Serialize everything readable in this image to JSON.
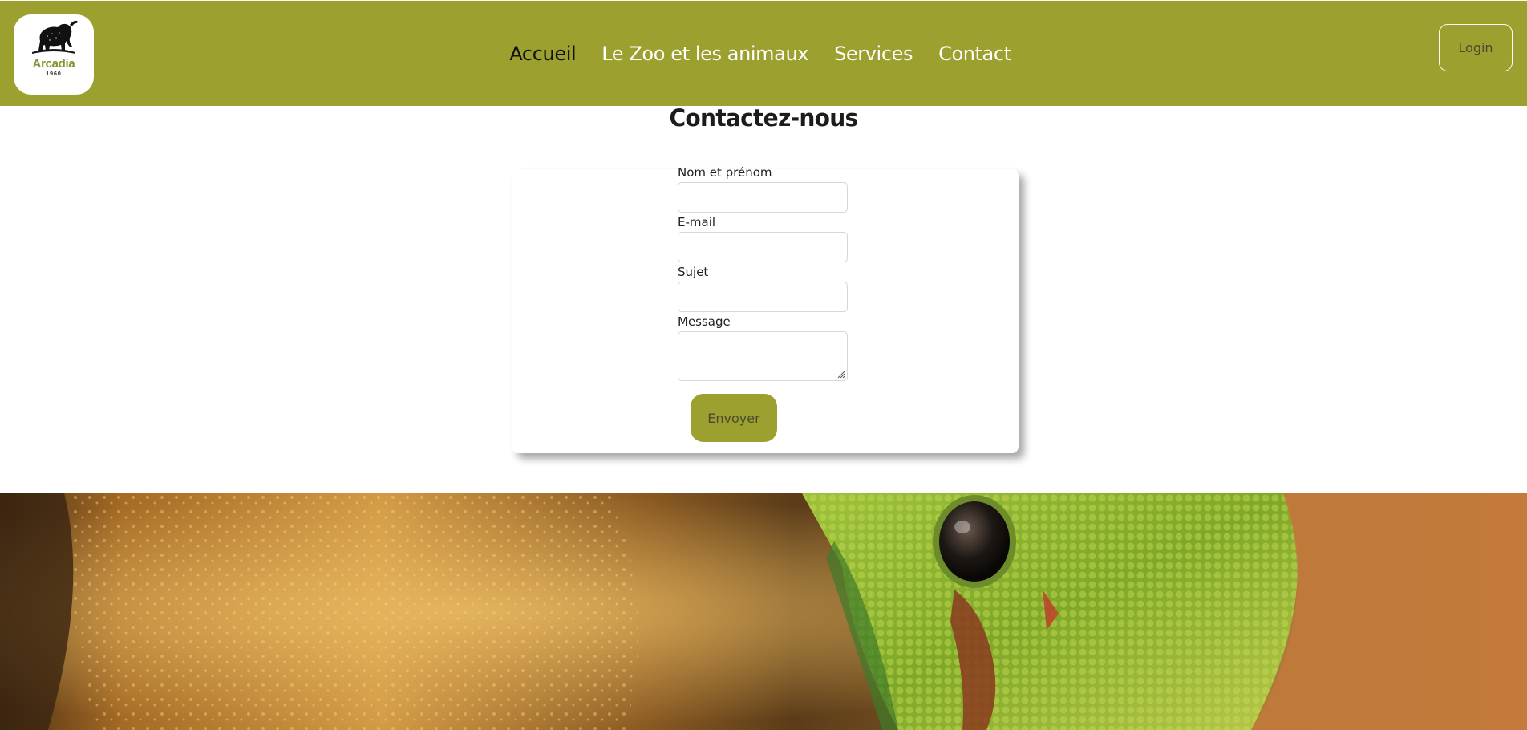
{
  "brand": {
    "logo_name": "Arcadia",
    "logo_year": "1960",
    "logo_icon": "elephant-icon"
  },
  "nav": {
    "items": [
      {
        "label": "Accueil",
        "active": true
      },
      {
        "label": "Le Zoo et les animaux",
        "active": false
      },
      {
        "label": "Services",
        "active": false
      },
      {
        "label": "Contact",
        "active": false
      }
    ],
    "login_label": "Login"
  },
  "contact": {
    "title": "Contactez-nous",
    "fields": {
      "name_label": "Nom et prénom",
      "email_label": "E-mail",
      "subject_label": "Sujet",
      "message_label": "Message"
    },
    "submit_label": "Envoyer"
  },
  "colors": {
    "brand_olive": "#9ba02e",
    "nav_active": "#111111",
    "nav_inactive": "#ffffff"
  },
  "hero": {
    "image": "gecko-closeup-photo"
  }
}
